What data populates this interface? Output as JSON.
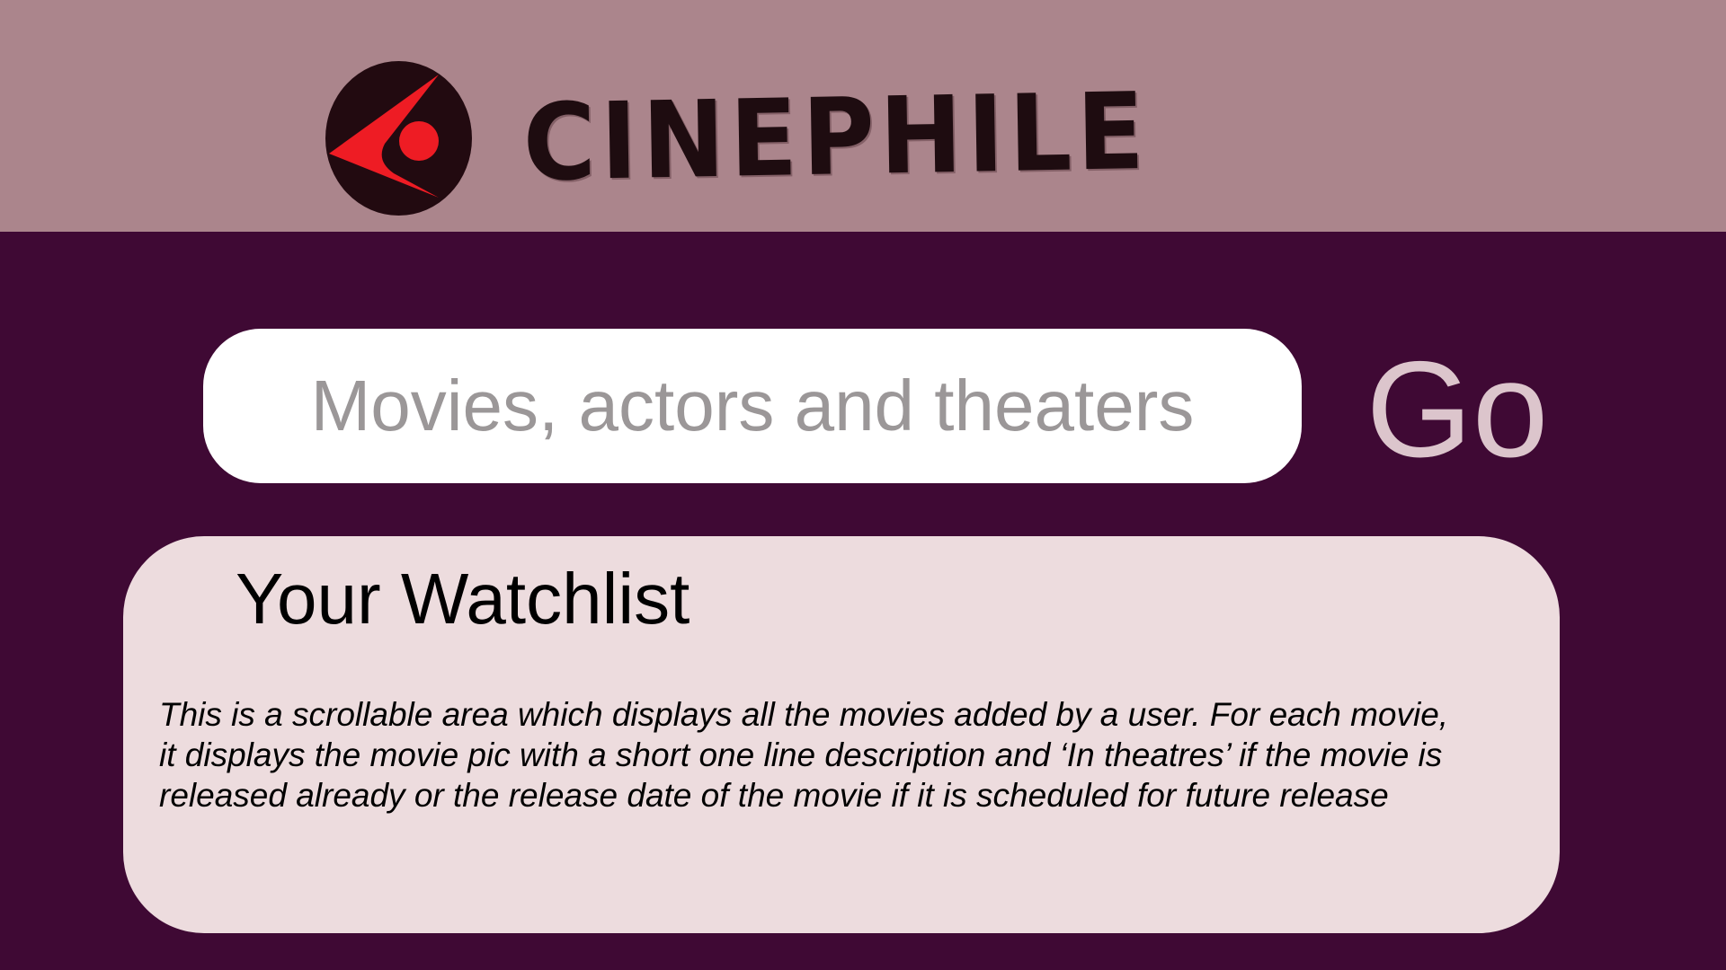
{
  "header": {
    "brand_name": "CINEPHILE",
    "logo_icon": "film-camera-logo-icon"
  },
  "search": {
    "placeholder": "Movies, actors and theaters",
    "value": "",
    "go_label": "Go"
  },
  "watchlist": {
    "title": "Your Watchlist",
    "description": "This is a scrollable area which displays all the movies added by a user. For each movie, it displays the movie pic with a short one line description and ‘In theatres’ if the movie is released already or the release date of the movie if it is scheduled for future release"
  },
  "colors": {
    "page_background": "#3f0934",
    "header_background": "#ab858c",
    "panel_background": "#eddcde",
    "go_text": "#dcc5cc",
    "logo_circle": "#220a10",
    "logo_red": "#ee1c24"
  }
}
